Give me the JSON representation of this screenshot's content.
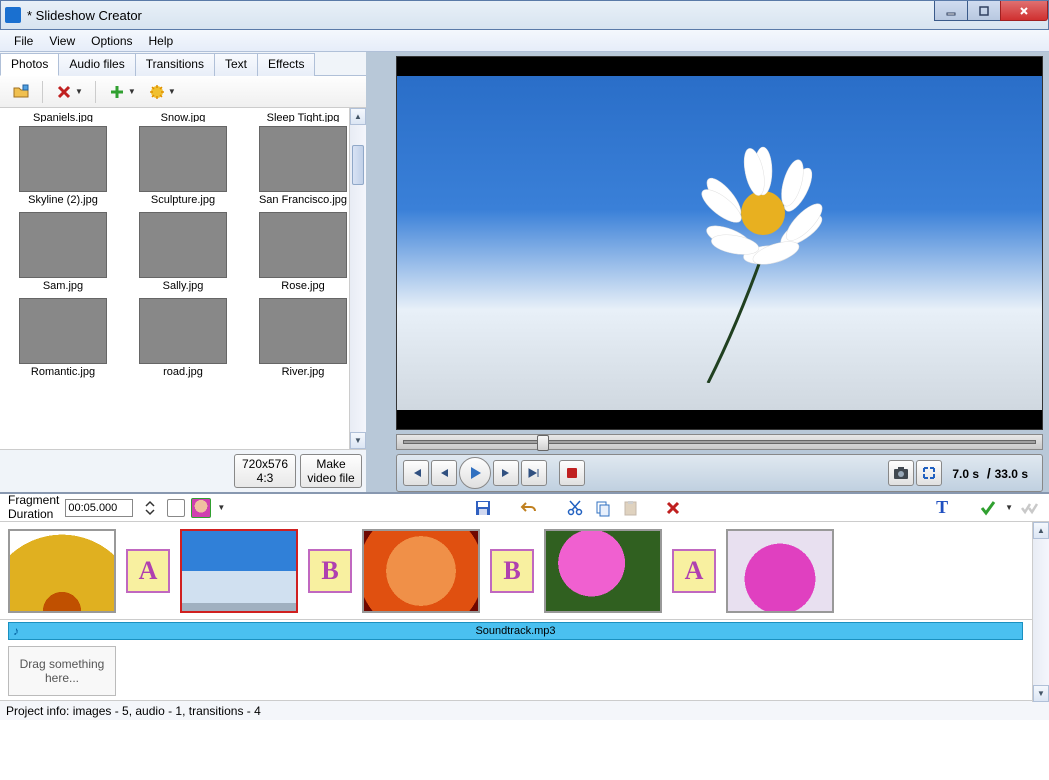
{
  "window": {
    "title": "*  Slideshow Creator"
  },
  "menu": {
    "items": [
      "File",
      "View",
      "Options",
      "Help"
    ]
  },
  "tabs": {
    "items": [
      "Photos",
      "Audio files",
      "Transitions",
      "Text",
      "Effects"
    ],
    "active": 0
  },
  "cutoff_labels": [
    "Spaniels.jpg",
    "Snow.jpg",
    "Sleep Tight.jpg"
  ],
  "thumbnails": [
    {
      "label": "Skyline (2).jpg",
      "cls": "img-skyline"
    },
    {
      "label": "Sculpture.jpg",
      "cls": "img-sculpture"
    },
    {
      "label": "San Francisco.jpg",
      "cls": "img-sanfrancisco"
    },
    {
      "label": "Sam.jpg",
      "cls": "img-sam"
    },
    {
      "label": "Sally.jpg",
      "cls": "img-sally"
    },
    {
      "label": "Rose.jpg",
      "cls": "img-rose"
    },
    {
      "label": "Romantic.jpg",
      "cls": "img-romantic"
    },
    {
      "label": "road.jpg",
      "cls": "img-road"
    },
    {
      "label": "River.jpg",
      "cls": "img-river"
    }
  ],
  "left_buttons": {
    "resolution_line1": "720x576",
    "resolution_line2": "4:3",
    "make_line1": "Make",
    "make_line2": "video file"
  },
  "preview": {
    "time_current": "7.0 s",
    "time_total": "33.0 s"
  },
  "timeline_toolbar": {
    "fragment_label_1": "Fragment",
    "fragment_label_2": "Duration",
    "fragment_value": "00:05.000"
  },
  "timeline_clips": [
    {
      "cls": "img-sunflower",
      "w": 108,
      "selected": false
    },
    {
      "trans": "A"
    },
    {
      "cls": "img-daisy",
      "w": 118,
      "selected": true
    },
    {
      "trans": "B"
    },
    {
      "cls": "img-rose",
      "w": 118,
      "selected": false
    },
    {
      "trans": "B"
    },
    {
      "cls": "img-pink",
      "w": 118,
      "selected": false
    },
    {
      "trans": "A"
    },
    {
      "cls": "img-pinkflower",
      "w": 108,
      "selected": false
    }
  ],
  "audio_track": {
    "name": "Soundtrack.mp3"
  },
  "drop_zone": {
    "text": "Drag something here..."
  },
  "status": {
    "text": "Project info: images - 5, audio - 1, transitions - 4"
  }
}
